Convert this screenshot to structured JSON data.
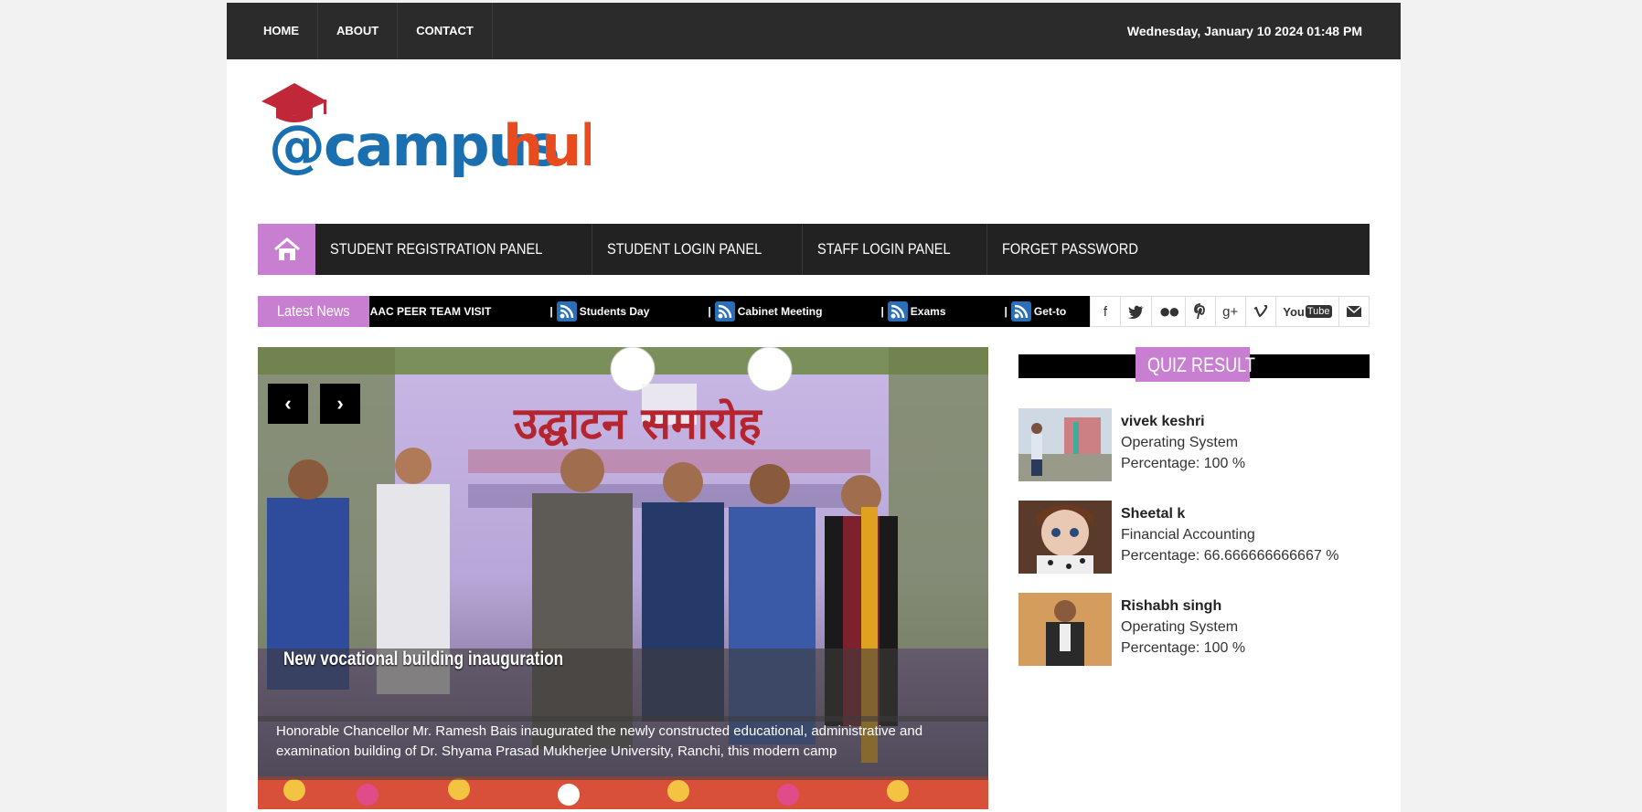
{
  "topbar": {
    "nav": [
      "HOME",
      "ABOUT",
      "CONTACT"
    ],
    "datetime": "Wednesday, January 10 2024 01:48 PM"
  },
  "logo": {
    "part1": "@campus",
    "part2": "hub"
  },
  "mainnav": {
    "items": [
      "STUDENT REGISTRATION PANEL",
      "STUDENT LOGIN PANEL",
      "STAFF LOGIN PANEL",
      "FORGET PASSWORD"
    ]
  },
  "news": {
    "label": "Latest News",
    "items": [
      "NAAC PEER TEAM VISIT",
      "Students Day",
      "Cabinet Meeting",
      "Exams",
      "Get-to"
    ]
  },
  "social": [
    "facebook",
    "twitter",
    "flickr",
    "pinterest",
    "google-plus",
    "vimeo",
    "youtube",
    "email"
  ],
  "slider": {
    "title": "New vocational building inauguration",
    "description": "Honorable Chancellor Mr. Ramesh Bais inaugurated the newly constructed educational, administrative and examination building of Dr. Shyama Prasad Mukherjee University, Ranchi, this modern camp",
    "banner_text": "उद्घाटन समारोह"
  },
  "quiz": {
    "title": "QUIZ RESULT",
    "results": [
      {
        "name": "vivek keshri",
        "subject": "Operating System",
        "percentage": "Percentage: 100 %"
      },
      {
        "name": "Sheetal k",
        "subject": "Financial Accounting",
        "percentage": "Percentage: 66.666666666667 %"
      },
      {
        "name": "Rishabh singh",
        "subject": "Operating System",
        "percentage": "Percentage: 100 %"
      }
    ]
  },
  "colors": {
    "accent": "#c97fd1",
    "dark": "#2b2b2b"
  }
}
